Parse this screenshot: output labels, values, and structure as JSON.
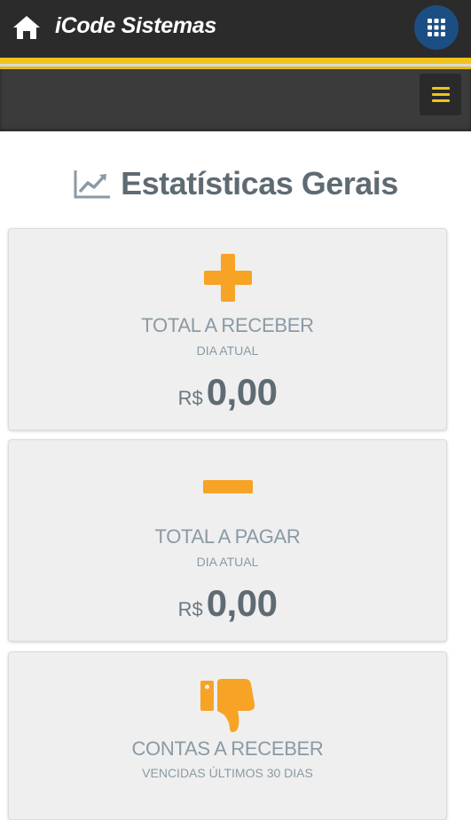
{
  "header": {
    "app_title": "iCode Sistemas",
    "icons": {
      "home": "home-icon",
      "apps": "apps-grid-icon",
      "menu": "hamburger-menu-icon"
    },
    "colors": {
      "bar": "#2b2b2b",
      "accent": "#f2c31a",
      "apps_button": "#1b4f83"
    }
  },
  "page": {
    "heading": "Estatísticas Gerais",
    "heading_icon": "line-chart-icon"
  },
  "cards": [
    {
      "icon": "plus-icon",
      "title": "TOTAL A RECEBER",
      "subtitle": "DIA ATUAL",
      "currency": "R$",
      "amount": "0,00"
    },
    {
      "icon": "minus-icon",
      "title": "TOTAL A PAGAR",
      "subtitle": "DIA ATUAL",
      "currency": "R$",
      "amount": "0,00"
    },
    {
      "icon": "thumbs-down-icon",
      "title": "CONTAS A RECEBER",
      "subtitle": "VENCIDAS ÚLTIMOS 30 DIAS"
    }
  ],
  "icon_color": "#f7a325"
}
